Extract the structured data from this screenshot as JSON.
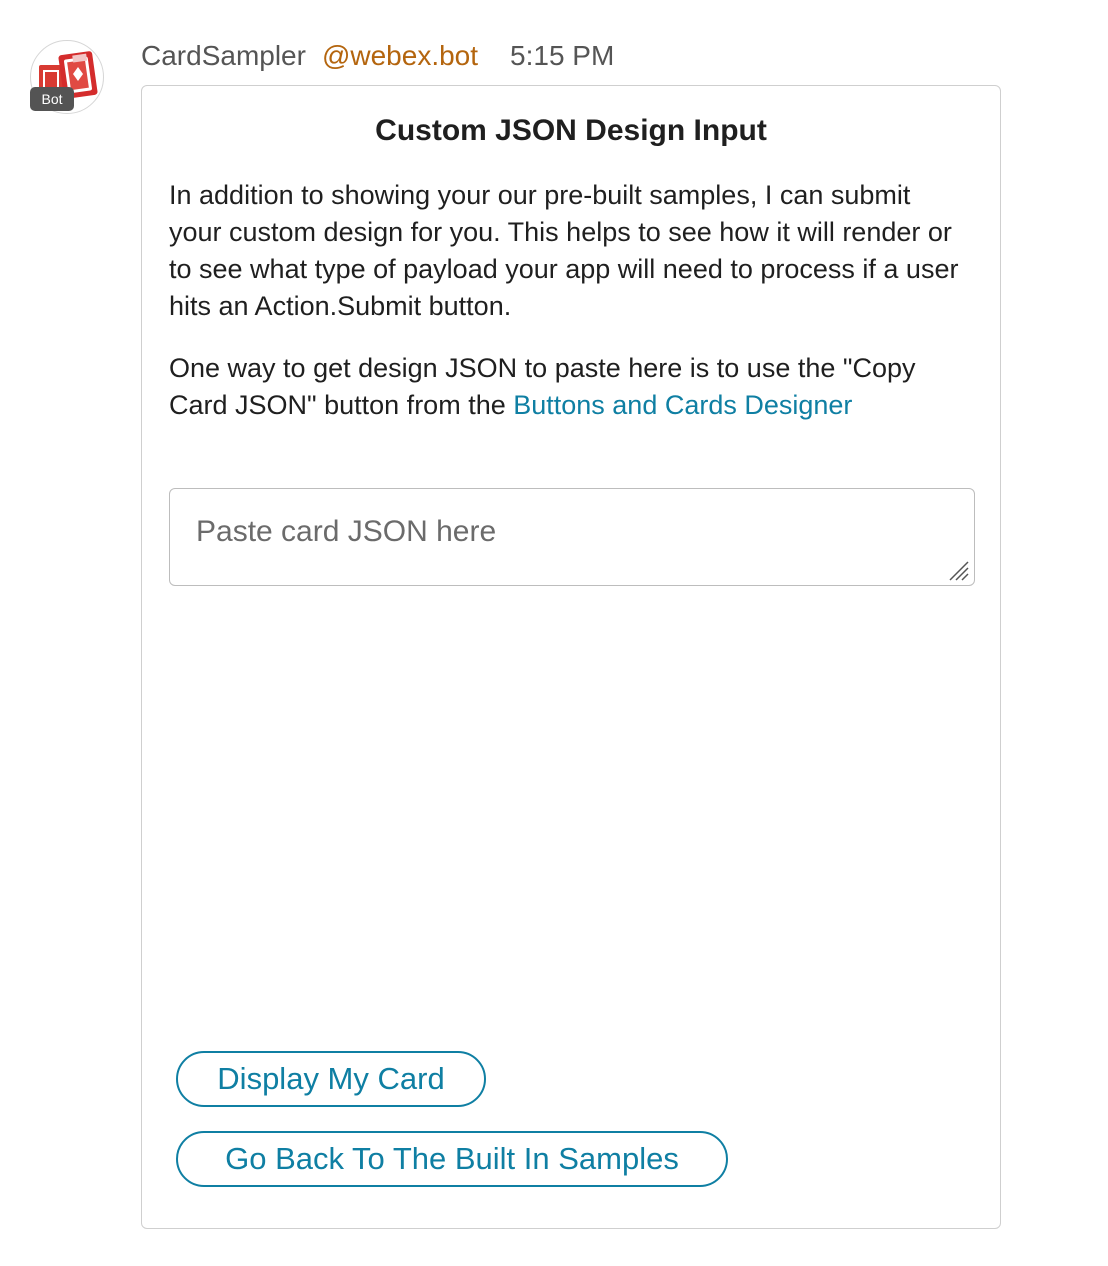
{
  "message": {
    "avatar_icon": "playing-cards-icon",
    "bot_badge": "Bot",
    "sender_name": "CardSampler",
    "sender_handle": "@webex.bot",
    "timestamp": "5:15 PM"
  },
  "card": {
    "title": "Custom JSON Design Input",
    "paragraph_1": "In addition to showing your our pre-built samples, I can submit your custom design for you. This helps to see how it will render or to see what type of payload your app will need to process if a user hits an Action.Submit button.",
    "paragraph_2_text": "One way to get design JSON to paste here is to use the \"Copy Card JSON\" button from the ",
    "paragraph_2_link": "Buttons and Cards Designer",
    "json_input": {
      "value": "",
      "placeholder": "Paste card JSON here"
    },
    "actions": {
      "display_label": "Display My Card",
      "back_label": "Go Back To The Built In Samples"
    }
  },
  "colors": {
    "link": "#0f7fa3",
    "handle": "#b4650e",
    "badge": "#545454",
    "border": "#cfcfcf"
  }
}
